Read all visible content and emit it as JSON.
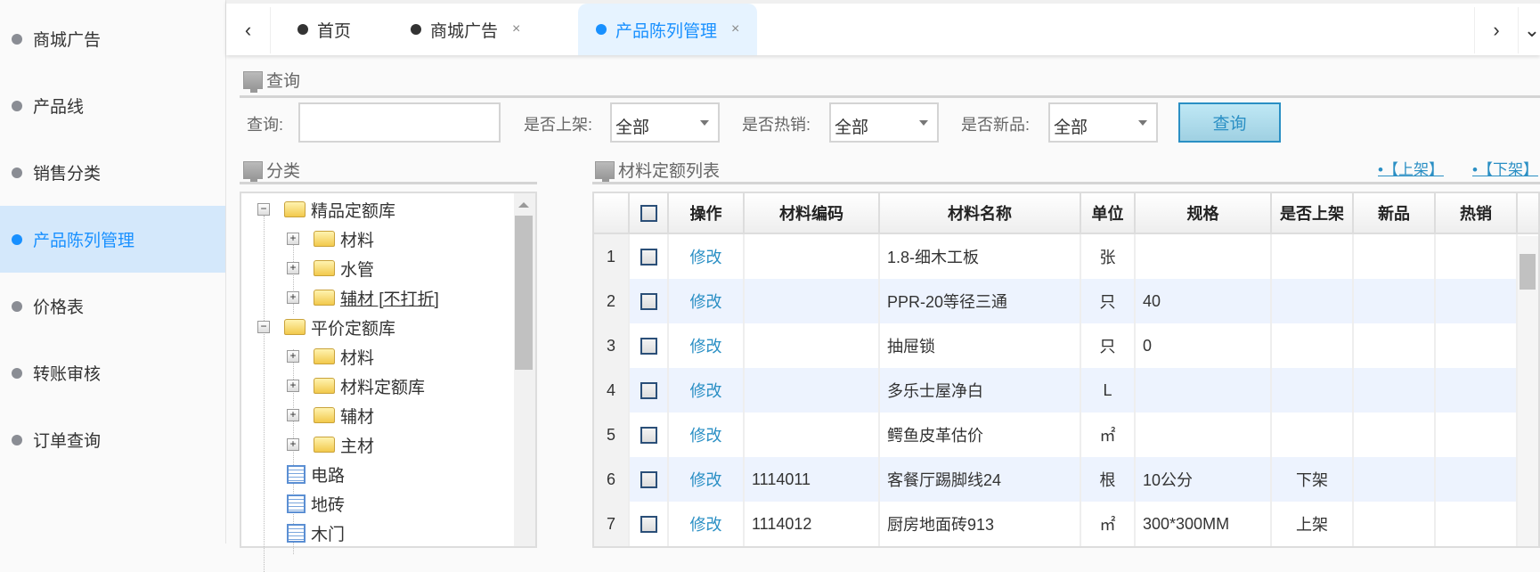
{
  "sidebar": {
    "items": [
      {
        "label": "商城广告"
      },
      {
        "label": "产品线"
      },
      {
        "label": "销售分类"
      },
      {
        "label": "产品陈列管理",
        "active": true
      },
      {
        "label": "价格表"
      },
      {
        "label": "转账审核"
      },
      {
        "label": "订单查询"
      }
    ]
  },
  "tabs": [
    {
      "label": "首页",
      "closable": false
    },
    {
      "label": "商城广告",
      "closable": true
    },
    {
      "label": "产品陈列管理",
      "closable": true,
      "active": true
    }
  ],
  "tab_close_glyph": "×",
  "query": {
    "title": "查询",
    "search_label": "查询:",
    "search_value": "",
    "shelf_label": "是否上架:",
    "shelf_value": "全部",
    "hot_label": "是否热销:",
    "hot_value": "全部",
    "new_label": "是否新品:",
    "new_value": "全部",
    "button": "查询"
  },
  "category": {
    "title": "分类",
    "tree": [
      {
        "label": "精品定额库",
        "level": 0,
        "type": "folder",
        "expanded": true
      },
      {
        "label": "材料",
        "level": 1,
        "type": "folder"
      },
      {
        "label": "水管",
        "level": 1,
        "type": "folder"
      },
      {
        "label": "辅材 [不打折]",
        "level": 1,
        "type": "folder",
        "underline": true
      },
      {
        "label": "平价定额库",
        "level": 0,
        "type": "folder",
        "expanded": true
      },
      {
        "label": "材料",
        "level": 1,
        "type": "folder"
      },
      {
        "label": "材料定额库",
        "level": 1,
        "type": "folder"
      },
      {
        "label": "辅材",
        "level": 1,
        "type": "folder"
      },
      {
        "label": "主材",
        "level": 1,
        "type": "folder"
      },
      {
        "label": "电路",
        "level": 1,
        "type": "leaf"
      },
      {
        "label": "地砖",
        "level": 1,
        "type": "leaf"
      },
      {
        "label": "木门",
        "level": 1,
        "type": "leaf"
      }
    ]
  },
  "list": {
    "title": "材料定额列表",
    "actions": [
      "•【上架】",
      "•【下架】"
    ],
    "columns": [
      "",
      "",
      "操作",
      "材料编码",
      "材料名称",
      "单位",
      "规格",
      "是否上架",
      "新品",
      "热销"
    ],
    "rows": [
      {
        "n": "1",
        "op": "修改",
        "code": "",
        "name": "1.8-细木工板",
        "unit": "张",
        "spec": "",
        "shelf": "",
        "new": "",
        "hot": ""
      },
      {
        "n": "2",
        "op": "修改",
        "code": "",
        "name": "PPR-20等径三通",
        "unit": "只",
        "spec": "40",
        "shelf": "",
        "new": "",
        "hot": ""
      },
      {
        "n": "3",
        "op": "修改",
        "code": "",
        "name": "抽屉锁",
        "unit": "只",
        "spec": "0",
        "shelf": "",
        "new": "",
        "hot": ""
      },
      {
        "n": "4",
        "op": "修改",
        "code": "",
        "name": "多乐士屋净白",
        "unit": "L",
        "spec": "",
        "shelf": "",
        "new": "",
        "hot": ""
      },
      {
        "n": "5",
        "op": "修改",
        "code": "",
        "name": "鳄鱼皮革估价",
        "unit": "㎡",
        "spec": "",
        "shelf": "",
        "new": "",
        "hot": ""
      },
      {
        "n": "6",
        "op": "修改",
        "code": "1114011",
        "name": "客餐厅踢脚线24",
        "unit": "根",
        "spec": "10公分",
        "shelf": "下架",
        "new": "",
        "hot": ""
      },
      {
        "n": "7",
        "op": "修改",
        "code": "1114012",
        "name": "厨房地面砖913",
        "unit": "㎡",
        "spec": "300*300MM",
        "shelf": "上架",
        "new": "",
        "hot": ""
      }
    ]
  },
  "colors": {
    "accent": "#1890ff",
    "link": "#2a8fc4",
    "active_bg": "#d4e8fb",
    "row_alt": "#edf3fe"
  }
}
